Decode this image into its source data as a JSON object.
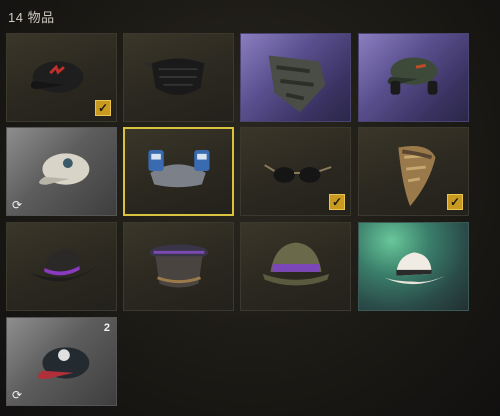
{
  "inventory": {
    "count_label": "14 物品"
  },
  "items": [
    {
      "icon": "black-cap-icon",
      "rarity": "common",
      "equipped": true,
      "duplicate": false
    },
    {
      "icon": "black-face-mask-icon",
      "rarity": "common",
      "equipped": false,
      "duplicate": false
    },
    {
      "icon": "camo-bandana-mask-icon",
      "rarity": "epic",
      "equipped": false,
      "duplicate": false
    },
    {
      "icon": "headset-cap-icon",
      "rarity": "epic",
      "equipped": false,
      "duplicate": false
    },
    {
      "icon": "white-cap-icon",
      "rarity": "rare",
      "equipped": false,
      "duplicate": true
    },
    {
      "icon": "helmet-goggles-icon",
      "rarity": "rare",
      "equipped": false,
      "duplicate": false,
      "selected": true
    },
    {
      "icon": "sunglasses-icon",
      "rarity": "common",
      "equipped": true,
      "duplicate": false
    },
    {
      "icon": "feather-headdress-icon",
      "rarity": "common",
      "equipped": true,
      "duplicate": false
    },
    {
      "icon": "cowboy-hat-icon",
      "rarity": "common",
      "equipped": false,
      "duplicate": false
    },
    {
      "icon": "officer-cap-icon",
      "rarity": "common",
      "equipped": false,
      "duplicate": false
    },
    {
      "icon": "pith-helmet-icon",
      "rarity": "common",
      "equipped": false,
      "duplicate": false
    },
    {
      "icon": "fedora-icon",
      "rarity": "legendary",
      "equipped": false,
      "duplicate": false
    },
    {
      "icon": "red-cap-icon",
      "rarity": "rare",
      "equipped": false,
      "duplicate": true,
      "stack_count": "2"
    }
  ],
  "glyphs": {
    "check": "✓",
    "duplicate": "⟳"
  },
  "colors": {
    "selected_border": "#d9c23e",
    "check_fill": "#c99a1f"
  }
}
